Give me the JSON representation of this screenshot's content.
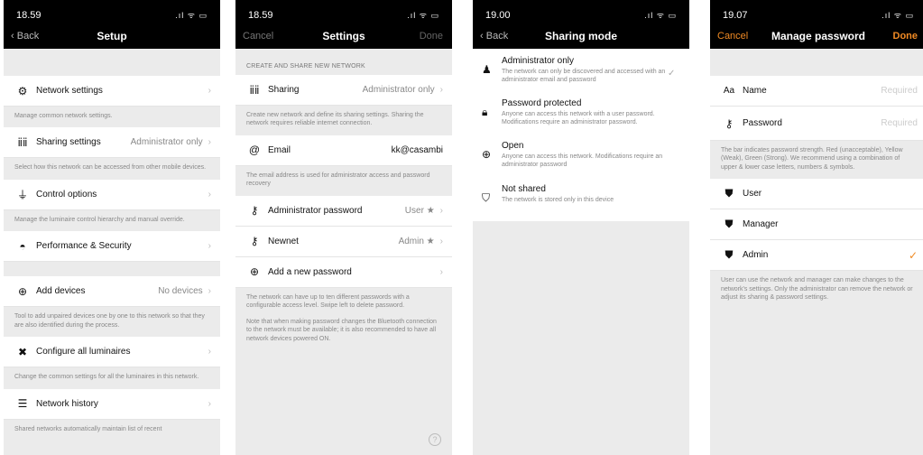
{
  "colors": {
    "accent": "#f08a24",
    "background": "#ebebeb",
    "bar": "#000000"
  },
  "s1": {
    "time": "18.59",
    "back": "Back",
    "title": "Setup",
    "items": [
      {
        "label": "Network settings",
        "value": "",
        "desc": "Manage common network settings.",
        "icon": "gear-icon"
      },
      {
        "label": "Sharing settings",
        "value": "Administrator only",
        "desc": "Select how this network can be accessed from other mobile devices.",
        "icon": "people-icon"
      },
      {
        "label": "Control options",
        "value": "",
        "desc": "Manage the luminaire control hierarchy and manual override.",
        "icon": "hierarchy-icon"
      },
      {
        "label": "Performance & Security",
        "value": "",
        "desc": "",
        "icon": "gauge-icon"
      },
      {
        "label": "Add devices",
        "value": "No devices",
        "desc": "Tool to add unpaired devices one by one to this network so that they are also identified during the process.",
        "icon": "plus-icon"
      },
      {
        "label": "Configure all luminaires",
        "value": "",
        "desc": "Change the common settings for all the luminaires in this network.",
        "icon": "tools-icon"
      },
      {
        "label": "Network history",
        "value": "",
        "desc": "Shared networks automatically maintain list of recent",
        "icon": "history-icon"
      }
    ]
  },
  "s2": {
    "time": "18.59",
    "cancel": "Cancel",
    "title": "Settings",
    "done": "Done",
    "section": "CREATE AND SHARE NEW NETWORK",
    "sharing": {
      "label": "Sharing",
      "value": "Administrator only",
      "desc": "Create new network and define its sharing settings. Sharing the network requires reliable internet connection."
    },
    "email": {
      "label": "Email",
      "value": "kk@casambi",
      "desc": "The email address is used for administrator access and password recovery"
    },
    "passwords": [
      {
        "label": "Administrator password",
        "value": "User ★"
      },
      {
        "label": "Newnet",
        "value": "Admin ★"
      }
    ],
    "add_password": "Add a new password",
    "desc1": "The network can have up to ten different passwords with a configurable access level. Swipe left to delete password.",
    "desc2": "Note that when making password changes the Bluetooth connection to the network must be available; it is also recommended to have all network devices powered ON.",
    "help": "?"
  },
  "s3": {
    "time": "19.00",
    "back": "Back",
    "title": "Sharing mode",
    "modes": [
      {
        "title": "Administrator only",
        "sub": "The network can only be discovered and accessed with an administrator email and password",
        "icon": "admin-icon",
        "check": "✓"
      },
      {
        "title": "Password protected",
        "sub": "Anyone can access this network with a user password. Modifications require an administrator password.",
        "icon": "lock-icon",
        "check": ""
      },
      {
        "title": "Open",
        "sub": "Anyone can access this network. Modifications require an administrator password",
        "icon": "globe-icon",
        "check": ""
      },
      {
        "title": "Not shared",
        "sub": "The network is stored only in this device",
        "icon": "no-share-icon",
        "check": ""
      }
    ]
  },
  "s4": {
    "time": "19.07",
    "cancel": "Cancel",
    "title": "Manage password",
    "done": "Done",
    "name_label": "Name",
    "name_placeholder": "Required",
    "password_label": "Password",
    "password_placeholder": "Required",
    "desc1": "The bar indicates password strength. Red (unacceptable), Yellow (Weak), Green (Strong). We recommend using a combination of upper & lower case letters, numbers & symbols.",
    "levels": [
      {
        "label": "User",
        "check": ""
      },
      {
        "label": "Manager",
        "check": ""
      },
      {
        "label": "Admin",
        "check": "✓"
      }
    ],
    "desc2": "User can use the network and manager can make changes to the network's settings. Only the administrator can remove the network or adjust its sharing & password settings."
  }
}
